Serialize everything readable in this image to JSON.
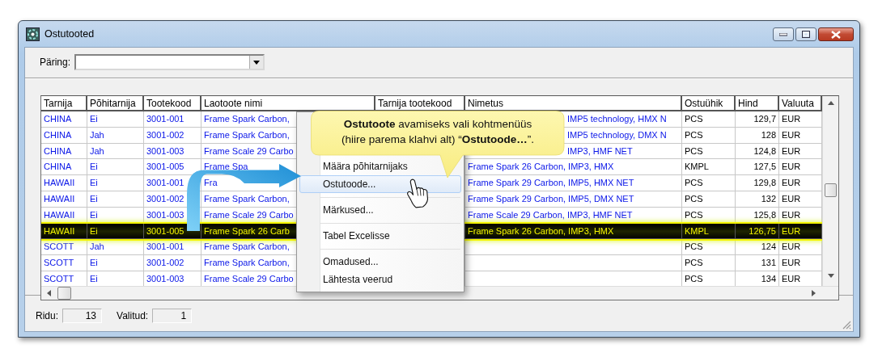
{
  "window": {
    "title": "Ostutooted"
  },
  "query": {
    "label": "Päring:"
  },
  "table": {
    "columns": [
      "Tarnija",
      "Põhitarnija",
      "Tootekood",
      "Laotoote nimi",
      "Tarnija tootekood",
      "Nimetus",
      "Ostuühik",
      "Hind",
      "Valuuta"
    ],
    "rows": [
      {
        "supplier": "CHINA",
        "main_supplier": "Ei",
        "code": "3001-001",
        "stock_name": "Frame Spark Carbon,",
        "name": "IMP5 technology, HMX N",
        "name_start_hidden": true,
        "unit": "PCS",
        "price": "129,7",
        "currency": "EUR",
        "selected": false
      },
      {
        "supplier": "CHINA",
        "main_supplier": "Jah",
        "code": "3001-002",
        "stock_name": "Frame Spark Carbon,",
        "name": "IMP5 technology, DMX N",
        "name_start_hidden": true,
        "unit": "PCS",
        "price": "128",
        "currency": "EUR",
        "selected": false
      },
      {
        "supplier": "CHINA",
        "main_supplier": "Jah",
        "code": "3001-003",
        "stock_name": "Frame Scale 29 Carbo",
        "name": "IMP3, HMF NET",
        "name_start_hidden": true,
        "unit": "PCS",
        "price": "124,8",
        "currency": "EUR",
        "selected": false
      },
      {
        "supplier": "CHINA",
        "main_supplier": "Ei",
        "code": "3001-005",
        "stock_name": "Frame Spa",
        "name": "Frame Spark 26 Carbon, IMP3, HMX",
        "name_start_hidden": false,
        "unit": "KMPL",
        "price": "127,5",
        "currency": "EUR",
        "selected": false
      },
      {
        "supplier": "HAWAII",
        "main_supplier": "Ei",
        "code": "3001-001",
        "stock_name": "Fra",
        "name": "Frame Spark 29 Carbon, IMP5, HMX NET",
        "name_start_hidden": false,
        "unit": "PCS",
        "price": "129,8",
        "currency": "EUR",
        "selected": false
      },
      {
        "supplier": "HAWAII",
        "main_supplier": "Ei",
        "code": "3001-002",
        "stock_name": "Frame Spark Carbon,",
        "name": "Frame Spark 29 Carbon, IMP5, DMX NET",
        "name_start_hidden": false,
        "unit": "PCS",
        "price": "132",
        "currency": "EUR",
        "selected": false
      },
      {
        "supplier": "HAWAII",
        "main_supplier": "Ei",
        "code": "3001-003",
        "stock_name": "Frame Scale 29 Carbo",
        "name": "Frame Scale 29 Carbon, IMP3, HMF NET",
        "name_start_hidden": false,
        "unit": "PCS",
        "price": "125,8",
        "currency": "EUR",
        "selected": false
      },
      {
        "supplier": "HAWAII",
        "main_supplier": "Ei",
        "code": "3001-005",
        "stock_name": "Frame Spark 26 Carb",
        "name": "Frame Spark 26 Carbon, IMP3, HMX",
        "name_start_hidden": false,
        "unit": "KMPL",
        "price": "126,75",
        "currency": "EUR",
        "selected": true
      },
      {
        "supplier": "SCOTT",
        "main_supplier": "Jah",
        "code": "3001-001",
        "stock_name": "Frame Spark Carbon,",
        "unit": "PCS",
        "price": "124",
        "currency": "EUR",
        "selected": false
      },
      {
        "supplier": "SCOTT",
        "main_supplier": "Ei",
        "code": "3001-002",
        "stock_name": "Frame Spark Carbon,",
        "unit": "PCS",
        "price": "131",
        "currency": "EUR",
        "selected": false
      },
      {
        "supplier": "SCOTT",
        "main_supplier": "Ei",
        "code": "3001-003",
        "stock_name": "Frame Scale 29 Carbo",
        "unit": "PCS",
        "price": "134",
        "currency": "EUR",
        "selected": false
      }
    ]
  },
  "context_menu": {
    "items": [
      {
        "label": "Määra põhitarnijaks",
        "selected": false,
        "separator_before": false
      },
      {
        "label": "Ostutoode...",
        "selected": true,
        "separator_before": false
      },
      {
        "label": "Märkused...",
        "selected": false,
        "separator_before": true
      },
      {
        "label": "Tabel Excelisse",
        "selected": false,
        "separator_before": true
      },
      {
        "label": "Omadused...",
        "selected": false,
        "separator_before": true
      },
      {
        "label": "Lähtesta veerud",
        "selected": false,
        "separator_before": false
      }
    ]
  },
  "callout": {
    "text": "**Ostutoote** avamiseks vali kohtmenüüs (hiire parema klahvi alt) “**Ostutoode…**”."
  },
  "status_bar": {
    "items": [
      {
        "label": "Ridu:",
        "value": "13"
      },
      {
        "label": "Valitud:",
        "value": "1"
      }
    ]
  }
}
